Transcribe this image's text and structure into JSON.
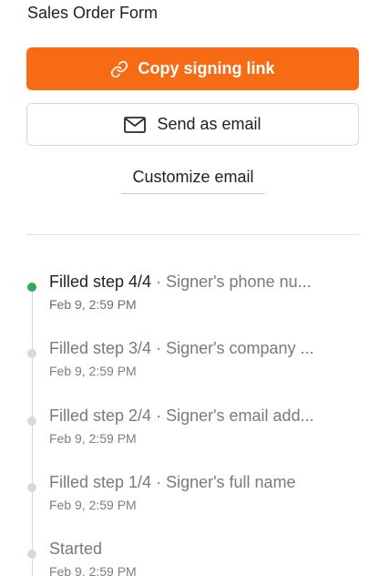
{
  "form": {
    "title": "Sales Order Form"
  },
  "actions": {
    "copy_link_label": "Copy signing link",
    "send_email_label": "Send as email",
    "customize_email_label": "Customize email"
  },
  "colors": {
    "primary": "#f76b15",
    "active_dot": "#3aa757",
    "inactive_dot": "#d9d9d9"
  },
  "timeline": [
    {
      "step": "Filled step 4/4",
      "separator": " · ",
      "detail": "Signer's phone nu...",
      "time": "Feb 9, 2:59 PM",
      "active": true
    },
    {
      "step": "Filled step 3/4",
      "separator": " · ",
      "detail": "Signer's company ...",
      "time": "Feb 9, 2:59 PM",
      "active": false
    },
    {
      "step": "Filled step 2/4",
      "separator": " · ",
      "detail": "Signer's email add...",
      "time": "Feb 9, 2:59 PM",
      "active": false
    },
    {
      "step": "Filled step 1/4",
      "separator": " · ",
      "detail": "Signer's full name",
      "time": "Feb 9, 2:59 PM",
      "active": false
    },
    {
      "step": "Started",
      "separator": "",
      "detail": "",
      "time": "Feb 9, 2:59 PM",
      "active": false
    }
  ]
}
